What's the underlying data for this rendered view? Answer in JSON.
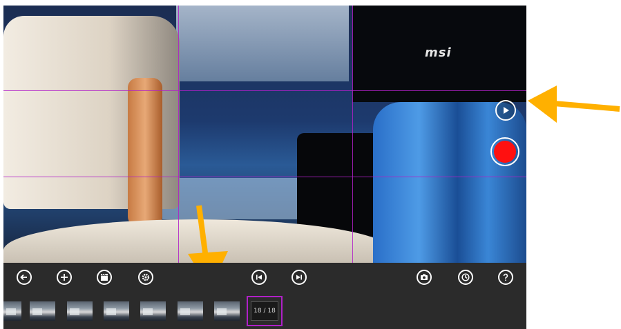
{
  "viewport": {
    "brand_text": "msi"
  },
  "overlay": {
    "play_icon": "play-icon",
    "record_icon": "record-icon",
    "record_color": "#ff1010"
  },
  "toolbar": {
    "buttons": [
      {
        "name": "back-button",
        "icon": "arrow-left-icon"
      },
      {
        "name": "add-button",
        "icon": "plus-icon"
      },
      {
        "name": "clapperboard-button",
        "icon": "clapperboard-icon"
      },
      {
        "name": "settings-button",
        "icon": "gear-icon"
      },
      {
        "name": "first-frame-button",
        "icon": "skip-start-icon"
      },
      {
        "name": "last-frame-button",
        "icon": "skip-end-icon"
      },
      {
        "name": "snapshot-button",
        "icon": "camera-icon"
      },
      {
        "name": "timer-button",
        "icon": "clock-icon"
      },
      {
        "name": "help-button",
        "icon": "help-icon"
      }
    ],
    "frame_counter": "18 / 18",
    "thumbnail_count": 7
  },
  "colors": {
    "grid_line": "#b020c8",
    "toolbar_bg": "#2b2b2b",
    "annotation_arrow": "#ffb000"
  }
}
